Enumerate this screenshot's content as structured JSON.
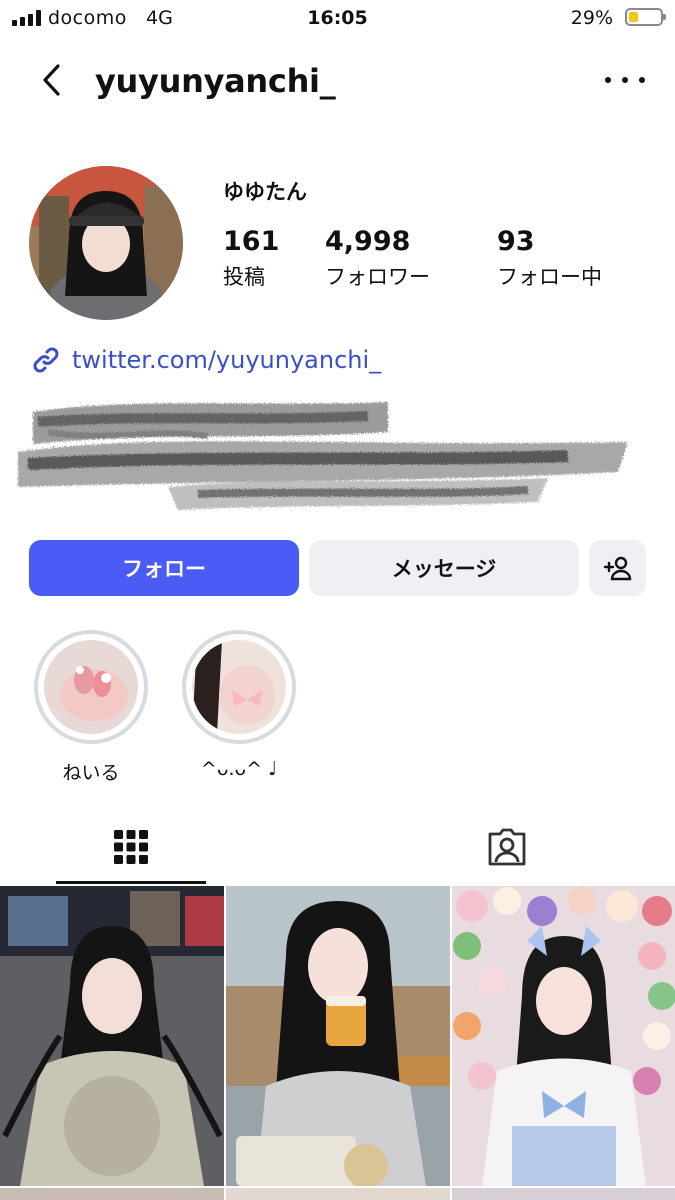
{
  "status_bar": {
    "carrier": "docomo",
    "network": "4G",
    "time": "16:05",
    "battery_percent": "29%",
    "battery_level": 0.29
  },
  "nav": {
    "username": "yuyunyanchi_",
    "back_icon": "chevron-left-icon",
    "more_icon": "more-horizontal-icon"
  },
  "profile": {
    "display_name": "ゆゆたん",
    "stats": [
      {
        "value": "161",
        "label": "投稿"
      },
      {
        "value": "4,998",
        "label": "フォロワー"
      },
      {
        "value": "93",
        "label": "フォロー中"
      }
    ],
    "link": "twitter.com/yuyunyanchi_",
    "link_icon": "link-icon"
  },
  "actions": {
    "follow_label": "フォロー",
    "message_label": "メッセージ",
    "add_person_icon": "add-person-icon"
  },
  "highlights": [
    {
      "label": "ねいる"
    },
    {
      "label": "^ᴗ.ᴗ^ ♩"
    }
  ],
  "tabs": {
    "grid_icon": "grid-icon",
    "tagged_icon": "tagged-person-icon"
  },
  "colors": {
    "accent": "#4a5cf5",
    "link": "#3a4fc9",
    "button_bg": "#eff0f3"
  }
}
